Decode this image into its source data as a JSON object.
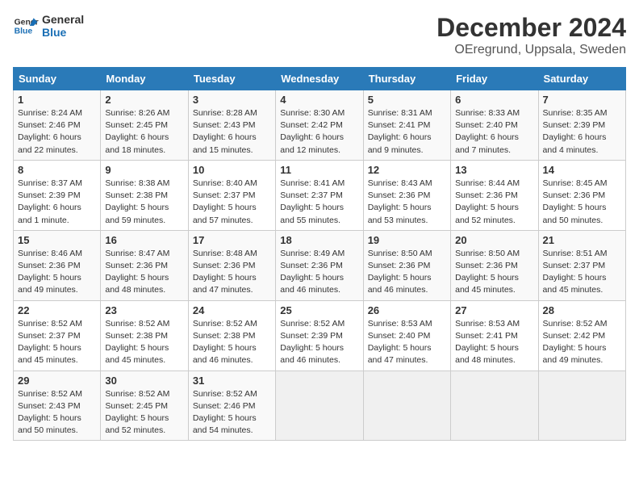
{
  "logo": {
    "line1": "General",
    "line2": "Blue"
  },
  "title": "December 2024",
  "subtitle": "OEregrund, Uppsala, Sweden",
  "headers": [
    "Sunday",
    "Monday",
    "Tuesday",
    "Wednesday",
    "Thursday",
    "Friday",
    "Saturday"
  ],
  "weeks": [
    [
      {
        "day": "1",
        "info": "Sunrise: 8:24 AM\nSunset: 2:46 PM\nDaylight: 6 hours\nand 22 minutes."
      },
      {
        "day": "2",
        "info": "Sunrise: 8:26 AM\nSunset: 2:45 PM\nDaylight: 6 hours\nand 18 minutes."
      },
      {
        "day": "3",
        "info": "Sunrise: 8:28 AM\nSunset: 2:43 PM\nDaylight: 6 hours\nand 15 minutes."
      },
      {
        "day": "4",
        "info": "Sunrise: 8:30 AM\nSunset: 2:42 PM\nDaylight: 6 hours\nand 12 minutes."
      },
      {
        "day": "5",
        "info": "Sunrise: 8:31 AM\nSunset: 2:41 PM\nDaylight: 6 hours\nand 9 minutes."
      },
      {
        "day": "6",
        "info": "Sunrise: 8:33 AM\nSunset: 2:40 PM\nDaylight: 6 hours\nand 7 minutes."
      },
      {
        "day": "7",
        "info": "Sunrise: 8:35 AM\nSunset: 2:39 PM\nDaylight: 6 hours\nand 4 minutes."
      }
    ],
    [
      {
        "day": "8",
        "info": "Sunrise: 8:37 AM\nSunset: 2:39 PM\nDaylight: 6 hours\nand 1 minute."
      },
      {
        "day": "9",
        "info": "Sunrise: 8:38 AM\nSunset: 2:38 PM\nDaylight: 5 hours\nand 59 minutes."
      },
      {
        "day": "10",
        "info": "Sunrise: 8:40 AM\nSunset: 2:37 PM\nDaylight: 5 hours\nand 57 minutes."
      },
      {
        "day": "11",
        "info": "Sunrise: 8:41 AM\nSunset: 2:37 PM\nDaylight: 5 hours\nand 55 minutes."
      },
      {
        "day": "12",
        "info": "Sunrise: 8:43 AM\nSunset: 2:36 PM\nDaylight: 5 hours\nand 53 minutes."
      },
      {
        "day": "13",
        "info": "Sunrise: 8:44 AM\nSunset: 2:36 PM\nDaylight: 5 hours\nand 52 minutes."
      },
      {
        "day": "14",
        "info": "Sunrise: 8:45 AM\nSunset: 2:36 PM\nDaylight: 5 hours\nand 50 minutes."
      }
    ],
    [
      {
        "day": "15",
        "info": "Sunrise: 8:46 AM\nSunset: 2:36 PM\nDaylight: 5 hours\nand 49 minutes."
      },
      {
        "day": "16",
        "info": "Sunrise: 8:47 AM\nSunset: 2:36 PM\nDaylight: 5 hours\nand 48 minutes."
      },
      {
        "day": "17",
        "info": "Sunrise: 8:48 AM\nSunset: 2:36 PM\nDaylight: 5 hours\nand 47 minutes."
      },
      {
        "day": "18",
        "info": "Sunrise: 8:49 AM\nSunset: 2:36 PM\nDaylight: 5 hours\nand 46 minutes."
      },
      {
        "day": "19",
        "info": "Sunrise: 8:50 AM\nSunset: 2:36 PM\nDaylight: 5 hours\nand 46 minutes."
      },
      {
        "day": "20",
        "info": "Sunrise: 8:50 AM\nSunset: 2:36 PM\nDaylight: 5 hours\nand 45 minutes."
      },
      {
        "day": "21",
        "info": "Sunrise: 8:51 AM\nSunset: 2:37 PM\nDaylight: 5 hours\nand 45 minutes."
      }
    ],
    [
      {
        "day": "22",
        "info": "Sunrise: 8:52 AM\nSunset: 2:37 PM\nDaylight: 5 hours\nand 45 minutes."
      },
      {
        "day": "23",
        "info": "Sunrise: 8:52 AM\nSunset: 2:38 PM\nDaylight: 5 hours\nand 45 minutes."
      },
      {
        "day": "24",
        "info": "Sunrise: 8:52 AM\nSunset: 2:38 PM\nDaylight: 5 hours\nand 46 minutes."
      },
      {
        "day": "25",
        "info": "Sunrise: 8:52 AM\nSunset: 2:39 PM\nDaylight: 5 hours\nand 46 minutes."
      },
      {
        "day": "26",
        "info": "Sunrise: 8:53 AM\nSunset: 2:40 PM\nDaylight: 5 hours\nand 47 minutes."
      },
      {
        "day": "27",
        "info": "Sunrise: 8:53 AM\nSunset: 2:41 PM\nDaylight: 5 hours\nand 48 minutes."
      },
      {
        "day": "28",
        "info": "Sunrise: 8:52 AM\nSunset: 2:42 PM\nDaylight: 5 hours\nand 49 minutes."
      }
    ],
    [
      {
        "day": "29",
        "info": "Sunrise: 8:52 AM\nSunset: 2:43 PM\nDaylight: 5 hours\nand 50 minutes."
      },
      {
        "day": "30",
        "info": "Sunrise: 8:52 AM\nSunset: 2:45 PM\nDaylight: 5 hours\nand 52 minutes."
      },
      {
        "day": "31",
        "info": "Sunrise: 8:52 AM\nSunset: 2:46 PM\nDaylight: 5 hours\nand 54 minutes."
      },
      null,
      null,
      null,
      null
    ]
  ]
}
